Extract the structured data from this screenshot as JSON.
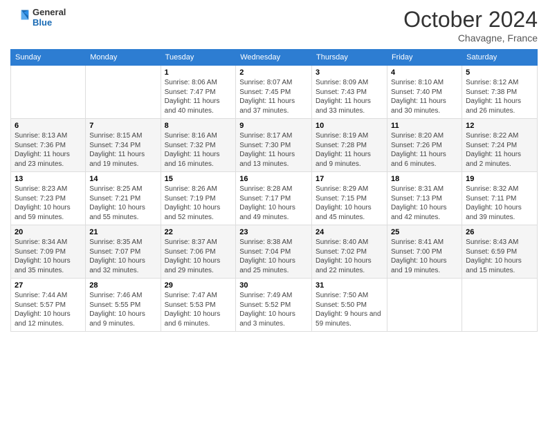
{
  "logo": {
    "line1": "General",
    "line2": "Blue"
  },
  "title": "October 2024",
  "location": "Chavagne, France",
  "weekdays": [
    "Sunday",
    "Monday",
    "Tuesday",
    "Wednesday",
    "Thursday",
    "Friday",
    "Saturday"
  ],
  "weeks": [
    [
      {
        "day": "",
        "info": ""
      },
      {
        "day": "",
        "info": ""
      },
      {
        "day": "1",
        "sunrise": "Sunrise: 8:06 AM",
        "sunset": "Sunset: 7:47 PM",
        "daylight": "Daylight: 11 hours and 40 minutes."
      },
      {
        "day": "2",
        "sunrise": "Sunrise: 8:07 AM",
        "sunset": "Sunset: 7:45 PM",
        "daylight": "Daylight: 11 hours and 37 minutes."
      },
      {
        "day": "3",
        "sunrise": "Sunrise: 8:09 AM",
        "sunset": "Sunset: 7:43 PM",
        "daylight": "Daylight: 11 hours and 33 minutes."
      },
      {
        "day": "4",
        "sunrise": "Sunrise: 8:10 AM",
        "sunset": "Sunset: 7:40 PM",
        "daylight": "Daylight: 11 hours and 30 minutes."
      },
      {
        "day": "5",
        "sunrise": "Sunrise: 8:12 AM",
        "sunset": "Sunset: 7:38 PM",
        "daylight": "Daylight: 11 hours and 26 minutes."
      }
    ],
    [
      {
        "day": "6",
        "sunrise": "Sunrise: 8:13 AM",
        "sunset": "Sunset: 7:36 PM",
        "daylight": "Daylight: 11 hours and 23 minutes."
      },
      {
        "day": "7",
        "sunrise": "Sunrise: 8:15 AM",
        "sunset": "Sunset: 7:34 PM",
        "daylight": "Daylight: 11 hours and 19 minutes."
      },
      {
        "day": "8",
        "sunrise": "Sunrise: 8:16 AM",
        "sunset": "Sunset: 7:32 PM",
        "daylight": "Daylight: 11 hours and 16 minutes."
      },
      {
        "day": "9",
        "sunrise": "Sunrise: 8:17 AM",
        "sunset": "Sunset: 7:30 PM",
        "daylight": "Daylight: 11 hours and 13 minutes."
      },
      {
        "day": "10",
        "sunrise": "Sunrise: 8:19 AM",
        "sunset": "Sunset: 7:28 PM",
        "daylight": "Daylight: 11 hours and 9 minutes."
      },
      {
        "day": "11",
        "sunrise": "Sunrise: 8:20 AM",
        "sunset": "Sunset: 7:26 PM",
        "daylight": "Daylight: 11 hours and 6 minutes."
      },
      {
        "day": "12",
        "sunrise": "Sunrise: 8:22 AM",
        "sunset": "Sunset: 7:24 PM",
        "daylight": "Daylight: 11 hours and 2 minutes."
      }
    ],
    [
      {
        "day": "13",
        "sunrise": "Sunrise: 8:23 AM",
        "sunset": "Sunset: 7:23 PM",
        "daylight": "Daylight: 10 hours and 59 minutes."
      },
      {
        "day": "14",
        "sunrise": "Sunrise: 8:25 AM",
        "sunset": "Sunset: 7:21 PM",
        "daylight": "Daylight: 10 hours and 55 minutes."
      },
      {
        "day": "15",
        "sunrise": "Sunrise: 8:26 AM",
        "sunset": "Sunset: 7:19 PM",
        "daylight": "Daylight: 10 hours and 52 minutes."
      },
      {
        "day": "16",
        "sunrise": "Sunrise: 8:28 AM",
        "sunset": "Sunset: 7:17 PM",
        "daylight": "Daylight: 10 hours and 49 minutes."
      },
      {
        "day": "17",
        "sunrise": "Sunrise: 8:29 AM",
        "sunset": "Sunset: 7:15 PM",
        "daylight": "Daylight: 10 hours and 45 minutes."
      },
      {
        "day": "18",
        "sunrise": "Sunrise: 8:31 AM",
        "sunset": "Sunset: 7:13 PM",
        "daylight": "Daylight: 10 hours and 42 minutes."
      },
      {
        "day": "19",
        "sunrise": "Sunrise: 8:32 AM",
        "sunset": "Sunset: 7:11 PM",
        "daylight": "Daylight: 10 hours and 39 minutes."
      }
    ],
    [
      {
        "day": "20",
        "sunrise": "Sunrise: 8:34 AM",
        "sunset": "Sunset: 7:09 PM",
        "daylight": "Daylight: 10 hours and 35 minutes."
      },
      {
        "day": "21",
        "sunrise": "Sunrise: 8:35 AM",
        "sunset": "Sunset: 7:07 PM",
        "daylight": "Daylight: 10 hours and 32 minutes."
      },
      {
        "day": "22",
        "sunrise": "Sunrise: 8:37 AM",
        "sunset": "Sunset: 7:06 PM",
        "daylight": "Daylight: 10 hours and 29 minutes."
      },
      {
        "day": "23",
        "sunrise": "Sunrise: 8:38 AM",
        "sunset": "Sunset: 7:04 PM",
        "daylight": "Daylight: 10 hours and 25 minutes."
      },
      {
        "day": "24",
        "sunrise": "Sunrise: 8:40 AM",
        "sunset": "Sunset: 7:02 PM",
        "daylight": "Daylight: 10 hours and 22 minutes."
      },
      {
        "day": "25",
        "sunrise": "Sunrise: 8:41 AM",
        "sunset": "Sunset: 7:00 PM",
        "daylight": "Daylight: 10 hours and 19 minutes."
      },
      {
        "day": "26",
        "sunrise": "Sunrise: 8:43 AM",
        "sunset": "Sunset: 6:59 PM",
        "daylight": "Daylight: 10 hours and 15 minutes."
      }
    ],
    [
      {
        "day": "27",
        "sunrise": "Sunrise: 7:44 AM",
        "sunset": "Sunset: 5:57 PM",
        "daylight": "Daylight: 10 hours and 12 minutes."
      },
      {
        "day": "28",
        "sunrise": "Sunrise: 7:46 AM",
        "sunset": "Sunset: 5:55 PM",
        "daylight": "Daylight: 10 hours and 9 minutes."
      },
      {
        "day": "29",
        "sunrise": "Sunrise: 7:47 AM",
        "sunset": "Sunset: 5:53 PM",
        "daylight": "Daylight: 10 hours and 6 minutes."
      },
      {
        "day": "30",
        "sunrise": "Sunrise: 7:49 AM",
        "sunset": "Sunset: 5:52 PM",
        "daylight": "Daylight: 10 hours and 3 minutes."
      },
      {
        "day": "31",
        "sunrise": "Sunrise: 7:50 AM",
        "sunset": "Sunset: 5:50 PM",
        "daylight": "Daylight: 9 hours and 59 minutes."
      },
      {
        "day": "",
        "info": ""
      },
      {
        "day": "",
        "info": ""
      }
    ]
  ]
}
